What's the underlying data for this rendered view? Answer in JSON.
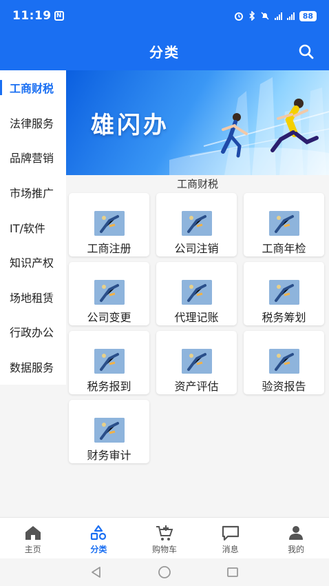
{
  "status_bar": {
    "time": "11:19",
    "n_badge": "N",
    "battery": "88"
  },
  "header": {
    "title": "分类"
  },
  "sidebar": {
    "items": [
      {
        "label": "工商财税"
      },
      {
        "label": "法律服务"
      },
      {
        "label": "品牌营销"
      },
      {
        "label": "市场推广"
      },
      {
        "label": "IT/软件"
      },
      {
        "label": "知识产权"
      },
      {
        "label": "场地租赁"
      },
      {
        "label": "行政办公"
      },
      {
        "label": "数据服务"
      }
    ]
  },
  "banner": {
    "text": "雄闪办"
  },
  "section": {
    "title": "工商财税"
  },
  "services": [
    {
      "label": "工商注册"
    },
    {
      "label": "公司注销"
    },
    {
      "label": "工商年检"
    },
    {
      "label": "公司变更"
    },
    {
      "label": "代理记账"
    },
    {
      "label": "税务筹划"
    },
    {
      "label": "税务报到"
    },
    {
      "label": "资产评估"
    },
    {
      "label": "验资报告"
    },
    {
      "label": "财务审计"
    }
  ],
  "tabbar": {
    "tabs": [
      {
        "label": "主页",
        "icon": "home-icon"
      },
      {
        "label": "分类",
        "icon": "category-icon"
      },
      {
        "label": "购物车",
        "icon": "cart-icon"
      },
      {
        "label": "消息",
        "icon": "message-icon"
      },
      {
        "label": "我的",
        "icon": "person-icon"
      }
    ],
    "active_index": 1
  },
  "colors": {
    "primary": "#1a6ff2",
    "background": "#f5f5f5"
  }
}
